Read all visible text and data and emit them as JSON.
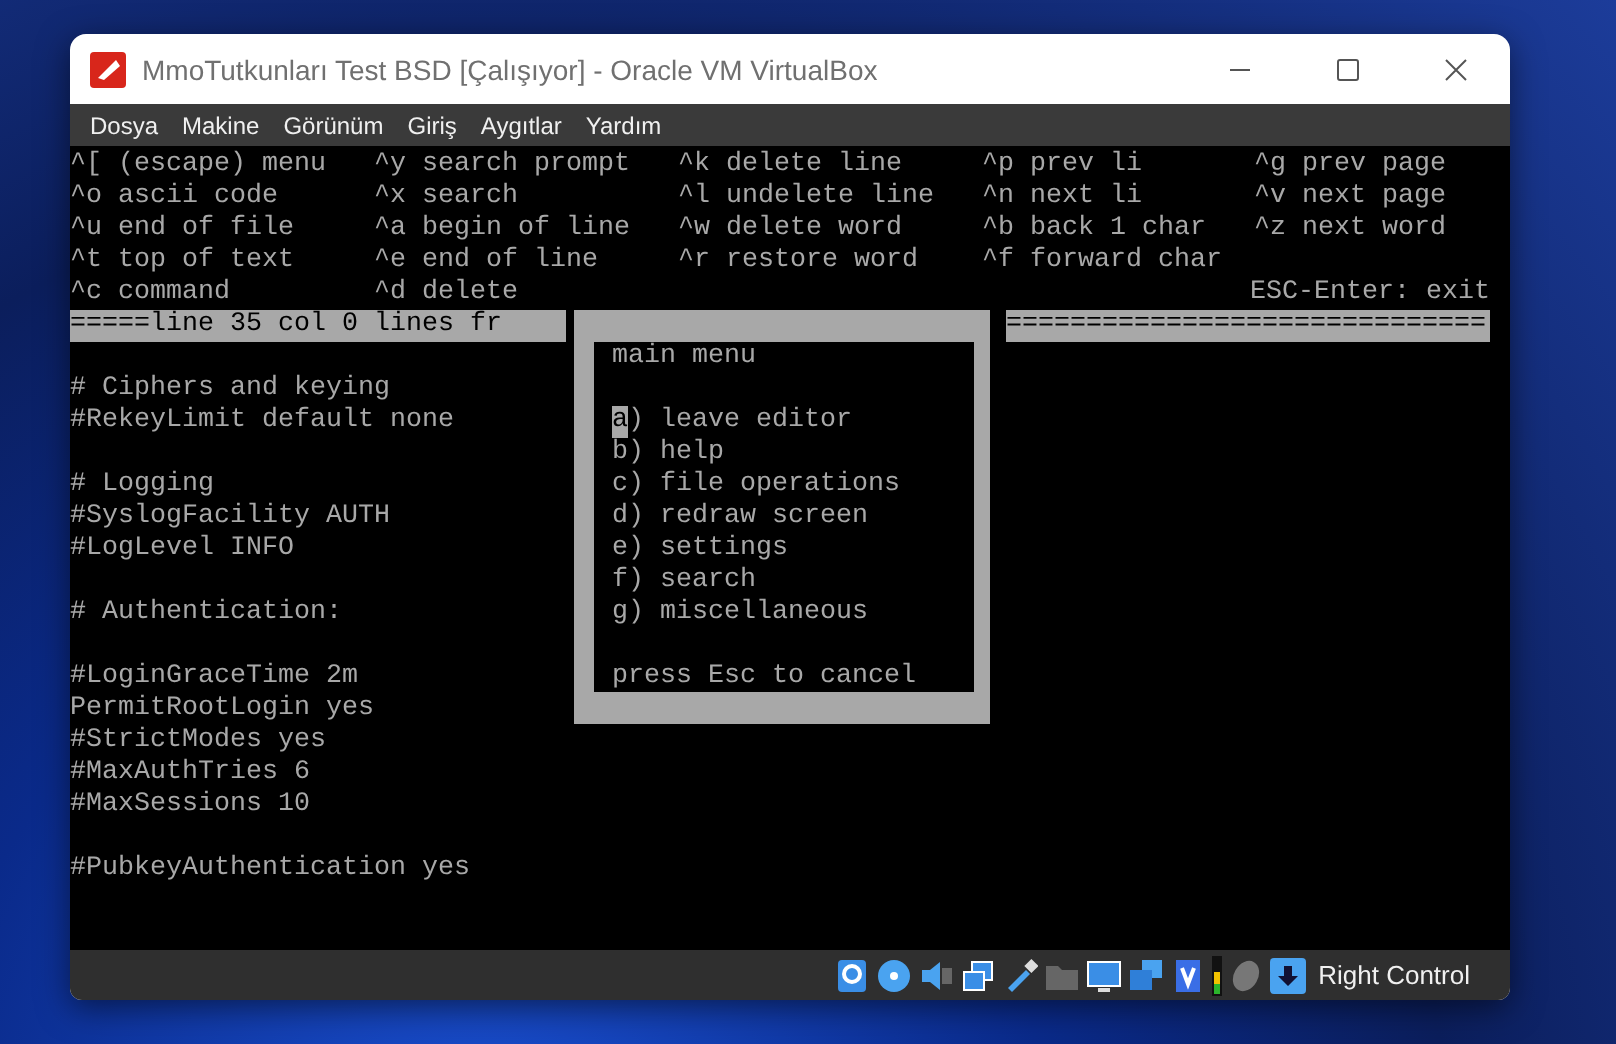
{
  "window": {
    "title": "MmoTutkunları Test BSD [Çalışıyor] - Oracle VM VirtualBox"
  },
  "menu_bar": [
    "Dosya",
    "Makine",
    "Görünüm",
    "Giriş",
    "Aygıtlar",
    "Yardım"
  ],
  "help_rows": [
    [
      "^[ (escape) menu",
      "^y search prompt",
      "^k delete line",
      "^p prev li",
      "^g prev page"
    ],
    [
      "^o ascii code",
      "^x search",
      "^l undelete line",
      "^n next li",
      "^v next page"
    ],
    [
      "^u end of file",
      "^a begin of line",
      "^w delete word",
      "^b back 1 char",
      "^z next word"
    ],
    [
      "^t top of text",
      "^e end of line",
      "^r restore word",
      "^f forward char"
    ],
    [
      "^c command",
      "^d delete"
    ]
  ],
  "exit_hint": "ESC-Enter: exit",
  "status_line": {
    "left": "=====line 35 col 0 lines fr",
    "right": "=============================="
  },
  "file_blocks": [
    [
      "# Ciphers and keying",
      "#RekeyLimit default none"
    ],
    [
      "# Logging",
      "#SyslogFacility AUTH",
      "#LogLevel INFO"
    ],
    [
      "# Authentication:"
    ],
    [
      "#LoginGraceTime 2m",
      "PermitRootLogin yes",
      "#StrictModes yes",
      "#MaxAuthTries 6",
      "#MaxSessions 10"
    ],
    [
      "#PubkeyAuthentication yes"
    ]
  ],
  "popup": {
    "title": "main menu",
    "items": [
      {
        "label": "a) leave editor",
        "selected": true
      },
      {
        "label": "b) help",
        "selected": false
      },
      {
        "label": "c) file operations",
        "selected": false
      },
      {
        "label": "d) redraw screen",
        "selected": false
      },
      {
        "label": "e) settings",
        "selected": false
      },
      {
        "label": "f) search",
        "selected": false
      },
      {
        "label": "g) miscellaneous",
        "selected": false
      }
    ],
    "footer": "press Esc to cancel"
  },
  "status_bar": {
    "host_key": "Right Control"
  }
}
